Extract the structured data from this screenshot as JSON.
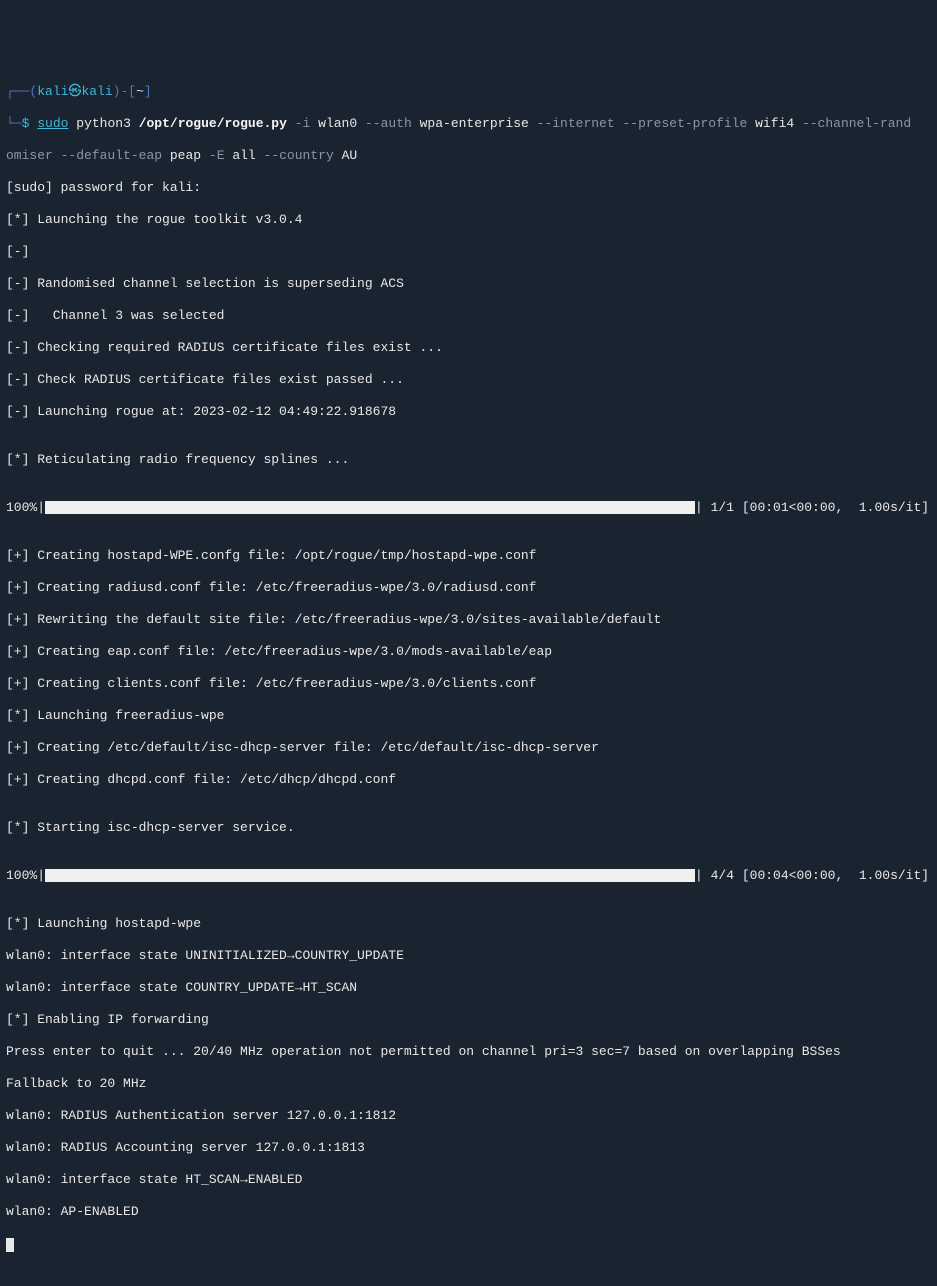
{
  "prompt": {
    "box_open": "┌──(",
    "user": "kali",
    "skull": "㉿",
    "host": "kali",
    "box_close": ")-[",
    "cwd": "~",
    "bracket_end": "]",
    "line2_prefix": "└─",
    "dollar": "$",
    "cmd_sudo": "sudo",
    "cmd_python": "python3",
    "cmd_script": "/opt/rogue/rogue.py",
    "flag_i": "-i",
    "arg_iface": "wlan0",
    "flag_auth": "--auth",
    "arg_auth": "wpa-enterprise",
    "flag_internet": "--internet",
    "flag_preset": "--preset-profile",
    "arg_preset": "wifi4",
    "flag_chanrand": "--channel-rand",
    "chanrand_wrap": "omiser",
    "flag_defaulteap": "--default-eap",
    "arg_eap": "peap",
    "flag_E": "-E",
    "arg_E": "all",
    "flag_country": "--country",
    "arg_country": "AU"
  },
  "lines": {
    "sudo_prompt": "[sudo] password for kali:",
    "l1": "[*] Launching the rogue toolkit v3.0.4",
    "l2": "[-]",
    "l3": "[-] Randomised channel selection is superseding ACS",
    "l4": "[-]   Channel 3 was selected",
    "l5": "[-] Checking required RADIUS certificate files exist ...",
    "l6": "[-] Check RADIUS certificate files exist passed ...",
    "l7": "[-] Launching rogue at: 2023-02-12 04:49:22.918678",
    "blank1": "",
    "l8": "[*] Reticulating radio frequency splines ...",
    "blank2": "",
    "pb1_pct": "100%",
    "pb1_stats": "| 1/1 [00:01<00:00,  1.00s/it]",
    "blank3": "",
    "l9": "[+] Creating hostapd-WPE.confg file: /opt/rogue/tmp/hostapd-wpe.conf",
    "l10": "[+] Creating radiusd.conf file: /etc/freeradius-wpe/3.0/radiusd.conf",
    "l11": "[+] Rewriting the default site file: /etc/freeradius-wpe/3.0/sites-available/default",
    "l12": "[+] Creating eap.conf file: /etc/freeradius-wpe/3.0/mods-available/eap",
    "l13": "[+] Creating clients.conf file: /etc/freeradius-wpe/3.0/clients.conf",
    "l14": "[*] Launching freeradius-wpe",
    "l15": "[+] Creating /etc/default/isc-dhcp-server file: /etc/default/isc-dhcp-server",
    "l16": "[+] Creating dhcpd.conf file: /etc/dhcp/dhcpd.conf",
    "blank4": "",
    "l17": "[*] Starting isc-dhcp-server service.",
    "blank5": "",
    "pb2_pct": "100%",
    "pb2_stats": "| 4/4 [00:04<00:00,  1.00s/it]",
    "blank6": "",
    "l18": "[*] Launching hostapd-wpe",
    "l19": "wlan0: interface state UNINITIALIZED→COUNTRY_UPDATE",
    "l20": "wlan0: interface state COUNTRY_UPDATE→HT_SCAN",
    "l21": "[*] Enabling IP forwarding",
    "l22": "Press enter to quit ... 20/40 MHz operation not permitted on channel pri=3 sec=7 based on overlapping BSSes",
    "l23": "Fallback to 20 MHz",
    "l24": "wlan0: RADIUS Authentication server 127.0.0.1:1812",
    "l25": "wlan0: RADIUS Accounting server 127.0.0.1:1813",
    "l26": "wlan0: interface state HT_SCAN→ENABLED",
    "l27": "wlan0: AP-ENABLED"
  }
}
